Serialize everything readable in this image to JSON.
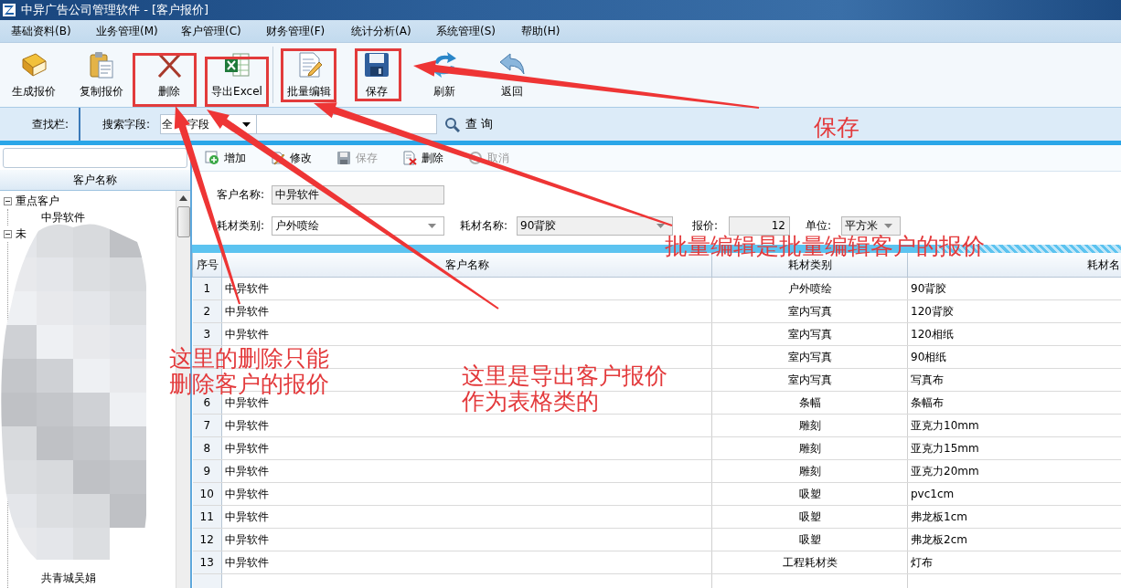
{
  "window": {
    "title": "中异广告公司管理软件 - [客户报价]"
  },
  "menu": [
    "基础资料(B)",
    "业务管理(M)",
    "客户管理(C)",
    "财务管理(F)",
    "统计分析(A)",
    "系统管理(S)",
    "帮助(H)"
  ],
  "toolbar": [
    {
      "label": "生成报价",
      "kind": "book"
    },
    {
      "label": "复制报价",
      "kind": "clipboard"
    },
    {
      "label": "删除",
      "kind": "delete"
    },
    {
      "label": "导出Excel",
      "kind": "excel"
    },
    {
      "label": "批量编辑",
      "kind": "edit"
    },
    {
      "label": "保存",
      "kind": "save"
    },
    {
      "label": "刷新",
      "kind": "refresh"
    },
    {
      "label": "返回",
      "kind": "back"
    }
  ],
  "search_bar": {
    "label": "查找栏:",
    "field_label": "搜索字段:",
    "field_value_parts": [
      "全",
      "字段"
    ],
    "button": "查 询"
  },
  "sidebar": {
    "header": "客户名称",
    "tree": [
      {
        "label": "重点客户",
        "expanded": true,
        "children": [
          {
            "label": "中异软件"
          }
        ]
      },
      {
        "label": "未",
        "expanded": true,
        "children": [
          {
            "label": "共青城吴娟"
          }
        ]
      }
    ]
  },
  "editor_toolbar": [
    {
      "label": "增加",
      "kind": "add",
      "disabled": false
    },
    {
      "label": "修改",
      "kind": "edit",
      "disabled": false
    },
    {
      "label": "保存",
      "kind": "save",
      "disabled": true
    },
    {
      "label": "删除",
      "kind": "delete",
      "disabled": false
    },
    {
      "label": "取消",
      "kind": "cancel",
      "disabled": true
    }
  ],
  "form": {
    "customer_label": "客户名称:",
    "customer_value": "中异软件",
    "category_label": "耗材类别:",
    "category_value": "户外喷绘",
    "material_label": "耗材名称:",
    "material_value": "90背胶",
    "price_label": "报价:",
    "price_value": "12",
    "unit_label": "单位:",
    "unit_value": "平方米"
  },
  "table": {
    "columns": [
      "序号",
      "客户名称",
      "耗材类别",
      "耗材名"
    ],
    "rows": [
      {
        "no": "1",
        "customer": "中异软件",
        "category": "户外喷绘",
        "material": "90背胶"
      },
      {
        "no": "2",
        "customer": "中异软件",
        "category": "室内写真",
        "material": "120背胶"
      },
      {
        "no": "3",
        "customer": "中异软件",
        "category": "室内写真",
        "material": "120相纸"
      },
      {
        "category": "室内写真",
        "material": "90相纸"
      },
      {
        "category": "室内写真",
        "material": "写真布"
      },
      {
        "no": "6",
        "customer": "中异软件",
        "category": "条幅",
        "material": "条幅布"
      },
      {
        "no": "7",
        "customer": "中异软件",
        "category": "雕刻",
        "material": "亚克力10mm"
      },
      {
        "no": "8",
        "customer": "中异软件",
        "category": "雕刻",
        "material": "亚克力15mm"
      },
      {
        "no": "9",
        "customer": "中异软件",
        "category": "雕刻",
        "material": "亚克力20mm"
      },
      {
        "no": "10",
        "customer": "中异软件",
        "category": "吸塑",
        "material": "pvc1cm"
      },
      {
        "no": "11",
        "customer": "中异软件",
        "category": "吸塑",
        "material": "弗龙板1cm"
      },
      {
        "no": "12",
        "customer": "中异软件",
        "category": "吸塑",
        "material": "弗龙板2cm"
      },
      {
        "no": "13",
        "customer": "中异软件",
        "category": "工程耗材类",
        "material": "灯布"
      }
    ]
  },
  "annotations": [
    {
      "lines": [
        "保存"
      ]
    },
    {
      "lines": [
        "批量编辑是批量编辑客户的报价"
      ]
    },
    {
      "lines": [
        "这里的删除只能",
        "删除客户的报价"
      ]
    },
    {
      "lines": [
        "这里是导出客户报价",
        "作为表格类的"
      ]
    }
  ]
}
